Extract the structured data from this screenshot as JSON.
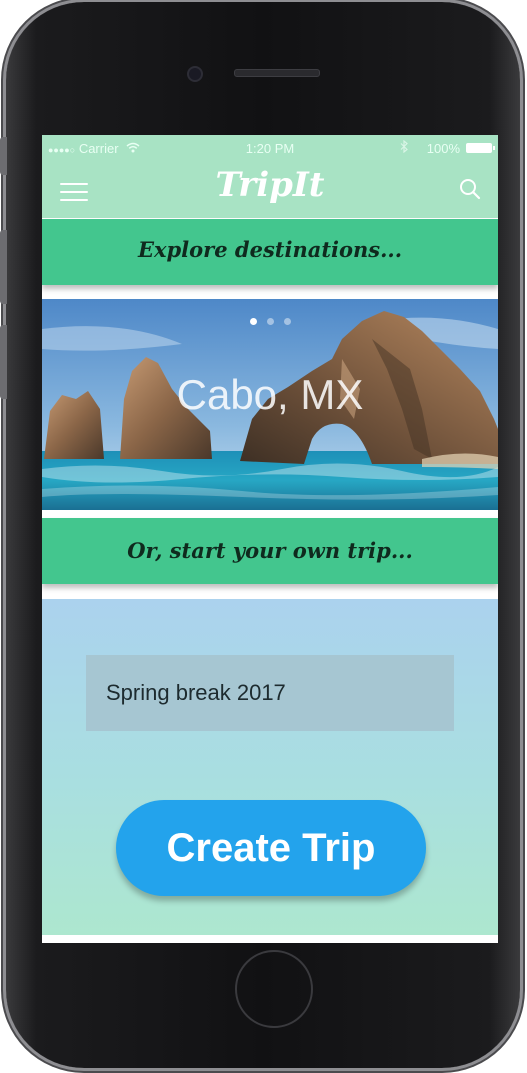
{
  "status_bar": {
    "signal": "●●●●○",
    "carrier": "Carrier",
    "time": "1:20 PM",
    "battery_text": "100%"
  },
  "header": {
    "brand": "TripIt",
    "menu_icon": "hamburger-menu-icon",
    "search_icon": "search-icon"
  },
  "explore": {
    "heading": "Explore destinations..."
  },
  "carousel": {
    "destination": "Cabo, MX",
    "slide_count": 3,
    "active_slide": 1
  },
  "create": {
    "heading": "Or, start your own trip...",
    "trip_name_value": "Spring break 2017",
    "button_label": "Create Trip"
  },
  "colors": {
    "nav_bg": "#a8e3c4",
    "banner_green": "#43c68e",
    "button_blue": "#23a3ec"
  }
}
